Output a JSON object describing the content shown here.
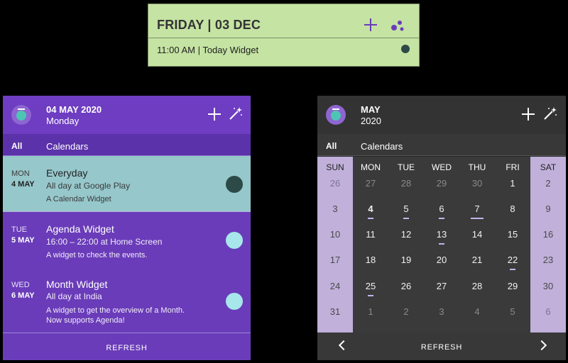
{
  "today_widget": {
    "date_title": "FRIDAY | 03 DEC",
    "event": "11:00 AM | Today Widget"
  },
  "agenda_widget": {
    "header_date": "04 MAY 2020",
    "header_day": "Monday",
    "filter_all": "All",
    "filter_calendars": "Calendars",
    "events": [
      {
        "dow": "MON",
        "date": "4 MAY",
        "title": "Everyday",
        "when": "All day at Google Play",
        "desc1": "A Calendar Widget",
        "desc2": ""
      },
      {
        "dow": "TUE",
        "date": "5 MAY",
        "title": "Agenda Widget",
        "when": "16:00 – 22:00 at Home Screen",
        "desc1": "A widget to check the events.",
        "desc2": ""
      },
      {
        "dow": "WED",
        "date": "6 MAY",
        "title": "Month Widget",
        "when": "All day at India",
        "desc1": "A widget to get the overview of a Month.",
        "desc2": "Now supports Agenda!"
      }
    ],
    "refresh": "REFRESH"
  },
  "month_widget": {
    "month": "MAY",
    "year": "2020",
    "filter_all": "All",
    "filter_calendars": "Calendars",
    "weekdays": [
      "SUN",
      "MON",
      "TUE",
      "WED",
      "THU",
      "FRI",
      "SAT"
    ],
    "weeks": [
      [
        "26",
        "27",
        "28",
        "29",
        "30",
        "1",
        "2"
      ],
      [
        "3",
        "4",
        "5",
        "6",
        "7",
        "8",
        "9"
      ],
      [
        "10",
        "11",
        "12",
        "13",
        "14",
        "15",
        "16"
      ],
      [
        "17",
        "18",
        "19",
        "20",
        "21",
        "22",
        "23"
      ],
      [
        "24",
        "25",
        "26",
        "27",
        "28",
        "29",
        "30"
      ],
      [
        "31",
        "1",
        "2",
        "3",
        "4",
        "5",
        "6"
      ]
    ],
    "refresh": "REFRESH"
  },
  "colors": {
    "today_bg": "#c5e3a3",
    "agenda_purple": "#6a3cb9",
    "agenda_selected": "#96c7cb",
    "event_dot_dark": "#2c4a47",
    "event_dot_light": "#a7e7ec",
    "month_bg": "#262626",
    "weekend_bg": "#c0b0da",
    "accent": "#6a3cb9"
  },
  "icons": [
    "plus-icon",
    "dots-icon",
    "magic-wand-icon",
    "app-logo-icon",
    "chevron-left-icon",
    "chevron-right-icon"
  ]
}
